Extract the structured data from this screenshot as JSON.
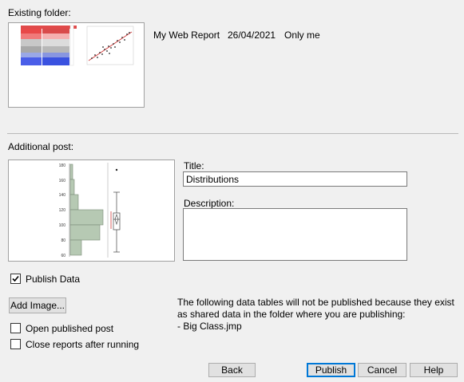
{
  "existing_folder": {
    "label": "Existing folder:",
    "report": {
      "name": "My Web Report",
      "date": "26/04/2021",
      "access": "Only me"
    }
  },
  "additional_post": {
    "label": "Additional post:",
    "title_label": "Title:",
    "title_value": "Distributions",
    "description_label": "Description:",
    "description_value": "",
    "histogram": {
      "y_ticks": [
        "180",
        "160",
        "140",
        "120",
        "100",
        "80",
        "60"
      ]
    }
  },
  "options": {
    "publish_data": {
      "label": "Publish Data",
      "checked": true
    },
    "add_image_label": "Add Image...",
    "open_published": {
      "label": "Open published post",
      "checked": false
    },
    "close_reports": {
      "label": "Close reports after running",
      "checked": false
    }
  },
  "notice": {
    "text": "The following data tables will not be published because they exist\nas shared data in the folder where you are publishing:\n- Big Class.jmp"
  },
  "footer": {
    "back_label": "Back",
    "publish_label": "Publish",
    "cancel_label": "Cancel",
    "help_label": "Help"
  },
  "colors": {
    "dialog_bg": "#f0f0f0",
    "histogram_fill": "#b6c9b3",
    "accent": "#0078d7"
  }
}
